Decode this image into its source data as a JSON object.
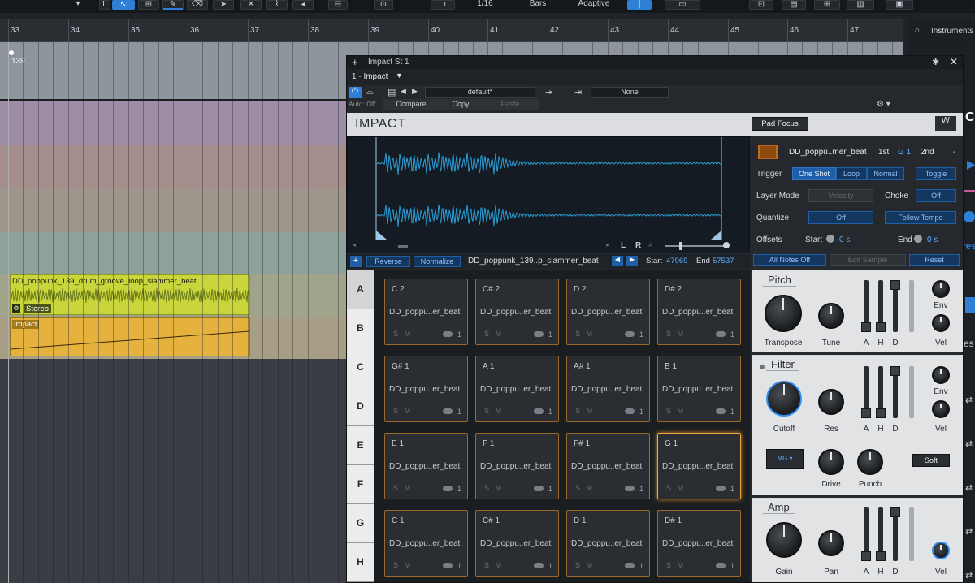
{
  "toolbar": {
    "quantize": "1/16",
    "timebase": "Bars",
    "snap": "Adaptive"
  },
  "ruler": {
    "bars": [
      "33",
      "34",
      "35",
      "36",
      "37",
      "38",
      "39",
      "40",
      "41",
      "42",
      "43",
      "44",
      "45",
      "46",
      "47"
    ]
  },
  "right_panel": {
    "title": "Instruments"
  },
  "arrange": {
    "tempo_marker": "139",
    "audio_clip_name": "DD_poppunk_139_drum_groove_loop_slammer_beat",
    "audio_clip_channel": "Stereo",
    "instrument_clip_name": "Impact"
  },
  "plugin": {
    "window_title": "Impact St 1",
    "instrument_select": "1 - Impact",
    "preset": "default*",
    "sidechain": "None",
    "auto_label": "Auto: Off",
    "compare": "Compare",
    "copy": "Copy",
    "paste": "Paste",
    "brand": "IMPACT",
    "pad_focus": "Pad Focus",
    "sample": {
      "name": "DD_poppu..mer_beat",
      "first": "1st",
      "note": "G 1",
      "second": "2nd",
      "dash": "-"
    },
    "trigger": {
      "label": "Trigger",
      "options": [
        "One Shot",
        "Loop",
        "Normal"
      ],
      "toggle": "Toggle"
    },
    "layer_mode": {
      "label": "Layer Mode",
      "value": "Velocity"
    },
    "choke": {
      "label": "Choke",
      "value": "Off"
    },
    "quantize": {
      "label": "Quantize",
      "value": "Off",
      "follow": "Follow Tempo"
    },
    "offsets": {
      "label": "Offsets",
      "start_label": "Start",
      "start_value": "0 s",
      "end_label": "End",
      "end_value": "0 s"
    },
    "wave_bar": {
      "reverse": "Reverse",
      "normalize": "Normalize",
      "file": "DD_poppunk_139..p_slammer_beat",
      "start_label": "Start",
      "start_value": "47969",
      "end_label": "End",
      "end_value": "57537",
      "lr_l": "L",
      "lr_r": "R"
    },
    "actions": {
      "all_notes_off": "All Notes Off",
      "edit_sample": "Edit Sample",
      "reset": "Reset"
    },
    "banks": [
      "A",
      "B",
      "C",
      "D",
      "E",
      "F",
      "G",
      "H"
    ],
    "pads": [
      {
        "note": "C 2",
        "name": "DD_poppu..er_beat"
      },
      {
        "note": "C# 2",
        "name": "DD_poppu..er_beat"
      },
      {
        "note": "D 2",
        "name": "DD_poppu..er_beat"
      },
      {
        "note": "D# 2",
        "name": "DD_poppu..er_beat"
      },
      {
        "note": "G# 1",
        "name": "DD_poppu..er_beat"
      },
      {
        "note": "A 1",
        "name": "DD_poppu..er_beat"
      },
      {
        "note": "A# 1",
        "name": "DD_poppu..er_beat"
      },
      {
        "note": "B 1",
        "name": "DD_poppu..er_beat"
      },
      {
        "note": "E 1",
        "name": "DD_poppu..er_beat"
      },
      {
        "note": "F 1",
        "name": "DD_poppu..er_beat"
      },
      {
        "note": "F# 1",
        "name": "DD_poppu..er_beat"
      },
      {
        "note": "G 1",
        "name": "DD_poppu..er_beat"
      },
      {
        "note": "C 1",
        "name": "DD_poppu..er_beat"
      },
      {
        "note": "C# 1",
        "name": "DD_poppu..er_beat"
      },
      {
        "note": "D 1",
        "name": "DD_poppu..er_beat"
      },
      {
        "note": "D# 1",
        "name": "DD_poppu..er_beat"
      }
    ],
    "pad_s": "S",
    "pad_m": "M",
    "pad_layers": "1",
    "pitch": {
      "title": "Pitch",
      "transpose": "Transpose",
      "tune": "Tune",
      "env": "Env",
      "vel": "Vel"
    },
    "filter": {
      "title": "Filter",
      "cutoff": "Cutoff",
      "res": "Res",
      "env": "Env",
      "vel": "Vel",
      "drive": "Drive",
      "punch": "Punch",
      "soft": "Soft",
      "mode": "MG"
    },
    "amp": {
      "title": "Amp",
      "gain": "Gain",
      "pan": "Pan",
      "vel": "Vel"
    },
    "fader_labels": [
      "A",
      "H",
      "D"
    ]
  },
  "colors": {
    "accent": "#2f7fd6",
    "pad_border": "#9a6a2a",
    "pad_selected": "#f0a63a",
    "audio_clip": "#c8d63c",
    "instrument_clip": "#e5b23e",
    "waveform": "#2a9fd8"
  }
}
